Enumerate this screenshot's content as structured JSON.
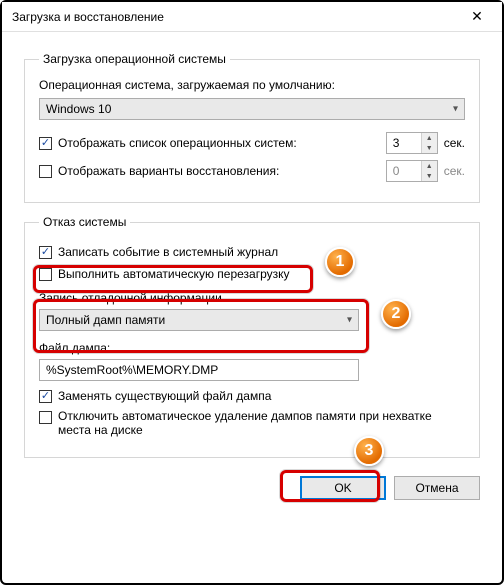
{
  "window": {
    "title": "Загрузка и восстановление"
  },
  "startup": {
    "legend": "Загрузка операционной системы",
    "default_os_label": "Операционная система, загружаемая по умолчанию:",
    "default_os_value": "Windows 10",
    "show_os_list_label": "Отображать список операционных систем:",
    "show_os_list_seconds": "3",
    "show_recovery_label": "Отображать варианты восстановления:",
    "show_recovery_seconds": "0",
    "seconds_suffix": "сек."
  },
  "failure": {
    "legend": "Отказ системы",
    "log_event_label": "Записать событие в системный журнал",
    "auto_restart_label": "Выполнить автоматическую перезагрузку",
    "debug_info_label": "Запись отладочной информации",
    "debug_info_value": "Полный дамп памяти",
    "dump_file_label": "Файл дампа:",
    "dump_file_value": "%SystemRoot%\\MEMORY.DMP",
    "overwrite_label": "Заменять существующий файл дампа",
    "disable_autodelete_label": "Отключить автоматическое удаление дампов памяти при нехватке места на диске"
  },
  "buttons": {
    "ok": "OK",
    "cancel": "Отмена"
  },
  "annotations": {
    "step1": "1",
    "step2": "2",
    "step3": "3"
  }
}
